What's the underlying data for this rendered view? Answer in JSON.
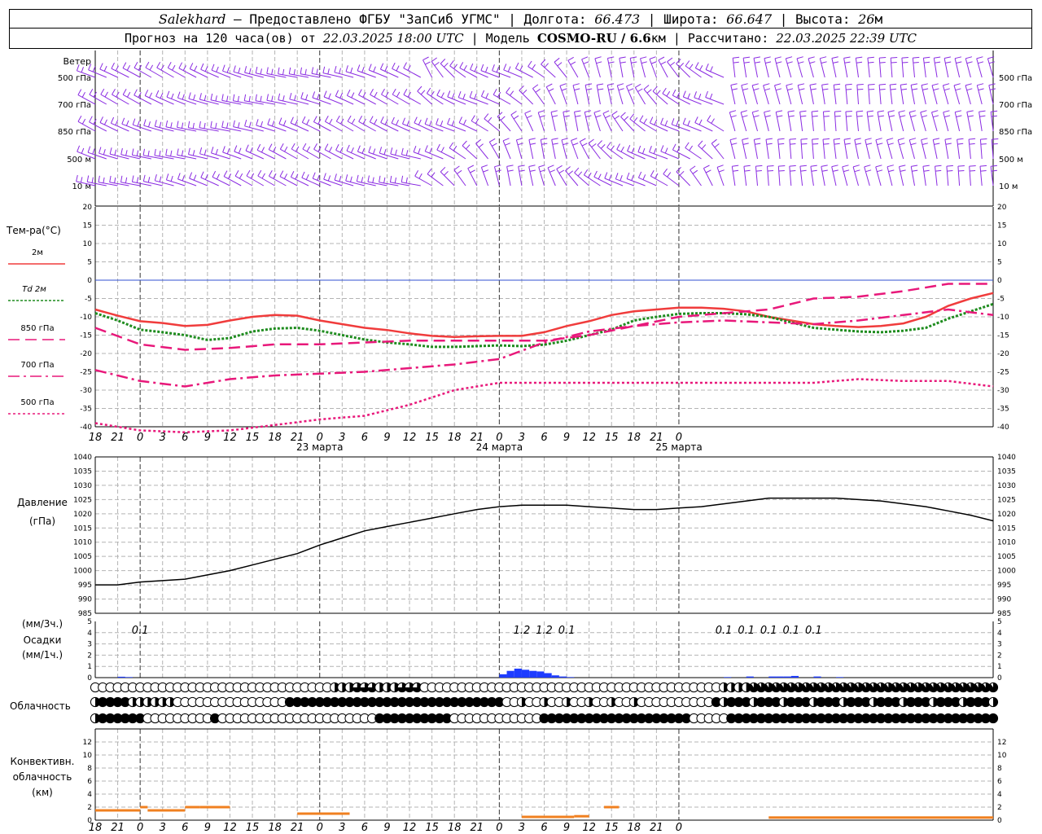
{
  "header": {
    "station": "Salekhard",
    "dash": " – ",
    "provided": "Предоставлено ФГБУ \"ЗапСиб УГМС\"",
    "sep": " | ",
    "lon_label": "Долгота: ",
    "lon": "66.473",
    "lat_label": "Широта: ",
    "lat": "66.647",
    "alt_label": "Высота: ",
    "alt": "26",
    "alt_unit": "м",
    "forecast_label": "Прогноз на 120 часа(ов) от ",
    "forecast_start": "22.03.2025 18:00 UTC",
    "model_label": "Модель ",
    "model": "COSMO-RU / 6.6",
    "model_unit": "км",
    "calc_label": "Рассчитано: ",
    "calc_time": "22.03.2025 22:39 UTC"
  },
  "colors": {
    "wind": "#8a2be2",
    "t2m": "#f03c3c",
    "td2m": "#1e8c1e",
    "t850": "#e8187a",
    "t700": "#e8187a",
    "t500": "#e8187a",
    "zero_line": "#3050d0",
    "pressure": "#000000",
    "precip": "#1e3cff",
    "convective": "#f08020",
    "grid": "#b4b4b4"
  },
  "wind_panel": {
    "title": "Ветер",
    "levels": [
      "500 гПа",
      "700 гПа",
      "850 гПа",
      "500 м",
      "10  м"
    ]
  },
  "time_axis": {
    "hour_ticks": [
      "18",
      "21",
      "0",
      "3",
      "6",
      "9",
      "12",
      "15",
      "18",
      "21",
      "0",
      "3",
      "6",
      "9",
      "12",
      "15",
      "18",
      "21",
      "0",
      "3",
      "6",
      "9",
      "12",
      "15",
      "18",
      "21",
      "0"
    ],
    "date_labels": [
      "23 марта",
      "24 марта",
      "25 марта"
    ]
  },
  "chart_data": [
    {
      "type": "line",
      "title": "Тем-ра(°С)",
      "x_unit": "hours from 22.03.2025 18:00 UTC",
      "ylim": [
        -40,
        20
      ],
      "y_ticks": [
        "20",
        "15",
        "10",
        "5",
        "0",
        "-5",
        "-10",
        "-15",
        "-20",
        "-25",
        "-30",
        "-35",
        "-40"
      ],
      "grid": true,
      "legend": [
        "2м",
        "Td  2м",
        "850 гПа",
        "700 гПа",
        "500 гПа"
      ],
      "series": [
        {
          "name": "2м",
          "x": [
            0,
            3,
            6,
            9,
            12,
            15,
            18,
            21,
            24,
            27,
            30,
            33,
            36,
            39,
            42,
            45,
            48,
            51,
            54,
            57,
            60,
            63,
            66,
            69,
            72,
            75,
            78,
            81,
            84,
            87,
            90,
            93,
            96,
            99,
            102,
            105,
            108,
            111,
            114,
            117,
            120
          ],
          "values": [
            -8,
            -9.7,
            -11.2,
            -11.7,
            -12.5,
            -12.2,
            -11,
            -10,
            -9.5,
            -9.7,
            -11,
            -12,
            -13,
            -13.6,
            -14.5,
            -15.2,
            -15.5,
            -15.3,
            -15.2,
            -15.2,
            -14.2,
            -12.5,
            -11.2,
            -9.5,
            -8.5,
            -8,
            -7.5,
            -7.5,
            -7.8,
            -8.5,
            -10,
            -11,
            -12,
            -12.5,
            -12.8,
            -12.5,
            -11.8,
            -10,
            -7,
            -5,
            -3.5
          ]
        },
        {
          "name": "Td  2м",
          "x": [
            0,
            3,
            6,
            9,
            12,
            15,
            18,
            21,
            24,
            27,
            30,
            33,
            36,
            39,
            42,
            45,
            48,
            51,
            54,
            57,
            60,
            63,
            66,
            69,
            72,
            75,
            78,
            81,
            84,
            87,
            90,
            93,
            96,
            99,
            102,
            105,
            108,
            111,
            114,
            117,
            120
          ],
          "values": [
            -9,
            -11,
            -13.5,
            -14.2,
            -15,
            -16.3,
            -15.8,
            -14,
            -13.2,
            -13,
            -13.8,
            -15,
            -16.2,
            -17,
            -17.5,
            -18.2,
            -18.2,
            -18,
            -17.8,
            -18,
            -17.6,
            -16.5,
            -15,
            -13.5,
            -11,
            -10,
            -9.2,
            -9,
            -9,
            -9.3,
            -10,
            -11.5,
            -13,
            -13.5,
            -14,
            -14.2,
            -13.8,
            -13,
            -10.5,
            -8.5,
            -6.5
          ]
        },
        {
          "name": "850 гПа",
          "x": [
            0,
            6,
            12,
            18,
            24,
            30,
            36,
            42,
            48,
            54,
            60,
            66,
            72,
            78,
            84,
            90,
            96,
            102,
            108,
            114,
            120
          ],
          "values": [
            -13,
            -17.5,
            -19,
            -18.5,
            -17.5,
            -17.5,
            -17,
            -16.5,
            -16.5,
            -16.5,
            -16.5,
            -15,
            -12.5,
            -10,
            -9,
            -8,
            -5,
            -4.5,
            -3,
            -1,
            -1
          ]
        },
        {
          "name": "700 гПа",
          "x": [
            0,
            6,
            12,
            18,
            24,
            30,
            36,
            42,
            48,
            54,
            60,
            66,
            72,
            78,
            84,
            90,
            96,
            102,
            108,
            114,
            120
          ],
          "values": [
            -24.5,
            -27.5,
            -29,
            -27,
            -26,
            -25.5,
            -25,
            -24,
            -23,
            -21.5,
            -17,
            -14,
            -12.5,
            -11.5,
            -11,
            -11.5,
            -12,
            -11,
            -9.5,
            -8,
            -9.5
          ]
        },
        {
          "name": "500 гПа",
          "x": [
            0,
            6,
            12,
            18,
            24,
            30,
            36,
            42,
            48,
            54,
            60,
            66,
            72,
            78,
            84,
            90,
            96,
            102,
            108,
            114,
            120
          ],
          "values": [
            -39,
            -41,
            -41.5,
            -41,
            -39.5,
            -38,
            -37,
            -34,
            -30,
            -28,
            -28,
            -28,
            -28,
            -28,
            -28,
            -28,
            -28,
            -27,
            -27.5,
            -27.5,
            -29
          ]
        }
      ]
    },
    {
      "type": "line",
      "title": "Давление",
      "ylabel": "(гПа)",
      "ylim": [
        985,
        1040
      ],
      "y_ticks": [
        "1040",
        "1035",
        "1030",
        "1025",
        "1020",
        "1015",
        "1010",
        "1005",
        "1000",
        "995",
        "990",
        "985"
      ],
      "grid": true,
      "series": [
        {
          "name": "Давление",
          "x": [
            0,
            3,
            6,
            9,
            12,
            15,
            18,
            21,
            24,
            27,
            30,
            33,
            36,
            39,
            42,
            45,
            48,
            51,
            54,
            57,
            60,
            63,
            66,
            69,
            72,
            75,
            78,
            81,
            84,
            87,
            90,
            93,
            96,
            99,
            102,
            105,
            108,
            111,
            114,
            117,
            120
          ],
          "values": [
            995,
            995,
            996,
            996.5,
            997,
            998.5,
            1000,
            1002,
            1004,
            1006,
            1009,
            1011.5,
            1014,
            1015.5,
            1017,
            1018.5,
            1020,
            1021.5,
            1022.5,
            1023,
            1023,
            1023,
            1022.5,
            1022,
            1021.5,
            1021.5,
            1022,
            1022.5,
            1023.5,
            1024.5,
            1025.5,
            1025.5,
            1025.5,
            1025.5,
            1025,
            1024.5,
            1023.5,
            1022.5,
            1021,
            1019.5,
            1017.5
          ]
        }
      ]
    },
    {
      "type": "bar",
      "title": "Осадки",
      "ylabel_top": "(мм/3ч.)",
      "ylabel_bottom": "(мм/1ч.)",
      "ylim": [
        0,
        5
      ],
      "y_ticks": [
        "5",
        "4",
        "3",
        "2",
        "1",
        "0"
      ],
      "grid": true,
      "labels_3h": [
        {
          "x": 6,
          "text": "0.1"
        },
        {
          "x": 57,
          "text": "1.2"
        },
        {
          "x": 60,
          "text": "1.2"
        },
        {
          "x": 63,
          "text": "0.1"
        },
        {
          "x": 84,
          "text": "0.1"
        },
        {
          "x": 87,
          "text": "0.1"
        },
        {
          "x": 90,
          "text": "0.1"
        },
        {
          "x": 93,
          "text": "0.1"
        },
        {
          "x": 96,
          "text": "0.1"
        }
      ],
      "series": [
        {
          "name": "1h",
          "x": [
            3,
            4,
            54,
            55,
            56,
            57,
            58,
            59,
            60,
            61,
            62,
            63,
            84,
            87,
            90,
            91,
            92,
            93,
            96,
            99
          ],
          "values": [
            0.08,
            0.05,
            0.3,
            0.6,
            0.8,
            0.7,
            0.6,
            0.55,
            0.4,
            0.2,
            0.1,
            0.05,
            0.05,
            0.1,
            0.1,
            0.1,
            0.1,
            0.15,
            0.1,
            0.05
          ]
        }
      ]
    },
    {
      "type": "table",
      "title": "Облачность",
      "rows": [
        "high",
        "middle",
        "low"
      ],
      "note": "pie symbols: fraction of cloud cover, hourly"
    },
    {
      "type": "bar",
      "title": "Конвективн. облачность",
      "ylabel": "(км)",
      "ylim": [
        0,
        14
      ],
      "y_ticks": [
        "12",
        "10",
        "8",
        "6",
        "4",
        "2",
        "0"
      ],
      "grid": true,
      "series": [
        {
          "name": "bottom",
          "x_ranges": [
            [
              0,
              6
            ],
            [
              6,
              7
            ],
            [
              7,
              12
            ],
            [
              12,
              14
            ],
            [
              14,
              18
            ],
            [
              27,
              34
            ],
            [
              57,
              64
            ],
            [
              64,
              66
            ],
            [
              68,
              70
            ],
            [
              90,
              120
            ]
          ],
          "values": [
            1.5,
            2,
            1.5,
            2,
            2,
            1,
            0.5,
            0.6,
            2,
            0.4
          ]
        }
      ]
    }
  ]
}
